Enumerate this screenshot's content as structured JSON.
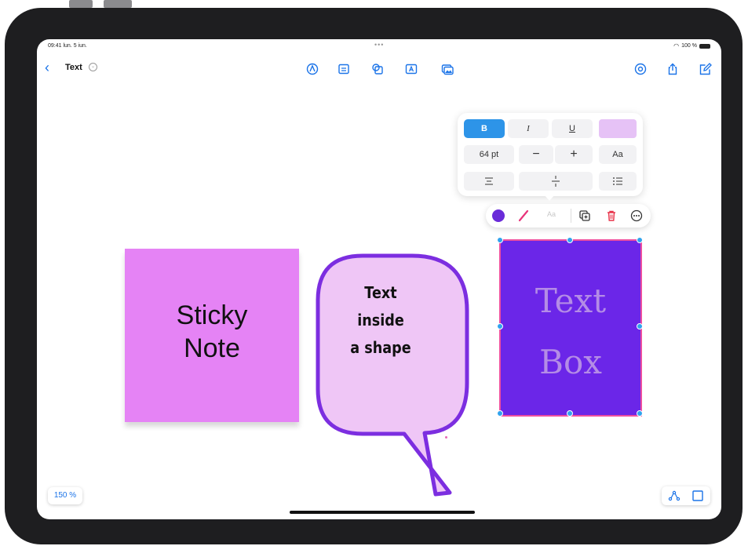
{
  "status": {
    "time": "09:41 lun. 5 iun.",
    "dots": "•••",
    "battery": "100 %"
  },
  "header": {
    "title": "Text"
  },
  "toolbar_icons": [
    "pen-icon",
    "sticky-note-icon",
    "shapes-icon",
    "text-box-icon",
    "media-icon",
    "collaborate-icon",
    "share-icon",
    "compose-icon"
  ],
  "format_panel": {
    "bold": "B",
    "italic": "I",
    "underline": "U",
    "size": "64 pt",
    "decrease": "−",
    "increase": "+",
    "font": "Aa",
    "text_color": "#e6c2f6"
  },
  "object_toolbar": {
    "fill_color": "#6a2bd9",
    "font_dim": "Aa"
  },
  "canvas": {
    "sticky_note": {
      "line1": "Sticky",
      "line2": "Note",
      "color": "#e583f5"
    },
    "shape": {
      "line1": "Text",
      "line2": "inside",
      "line3": "a shape",
      "fill": "#efc6f6",
      "stroke": "#7c2ee0"
    },
    "text_box": {
      "line1": "Text",
      "line2": "Box",
      "fill": "#6b26e8",
      "border": "#ee4fa0",
      "text_color": "#b48ce6"
    }
  },
  "zoom": "150 %"
}
